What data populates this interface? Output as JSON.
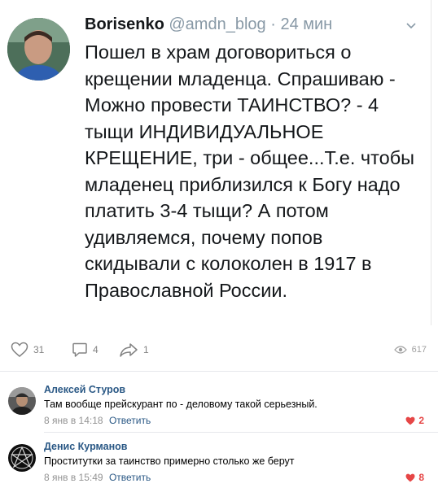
{
  "tweet": {
    "author_name": "Borisenko",
    "handle": "@amdn_blog",
    "separator": "·",
    "time": "24 мин",
    "text": "Пошел в храм договориться о крещении младенца. Спрашиваю - Можно провести ТАИНСТВО? - 4 тыщи ИНДИВИДУАЛЬНОЕ КРЕЩЕНИЕ, три - общее...Т.е. чтобы младенец приблизился к Богу надо платить 3-4 тыщи? А потом удивляемся, почему попов скидывали с колоколен в 1917 в Православной России."
  },
  "actions": {
    "likes": "31",
    "comments": "4",
    "shares": "1",
    "views": "617"
  },
  "comments": [
    {
      "author": "Алексей Стуров",
      "text": "Там вообще прейскурант по - деловому такой серьезный.",
      "time": "8 янв в 14:18",
      "reply_label": "Ответить",
      "likes": "2"
    },
    {
      "author": "Денис Курманов",
      "text": "Проститутки за таинство примерно столько же берут",
      "time": "8 янв в 15:49",
      "reply_label": "Ответить",
      "likes": "8"
    }
  ],
  "colors": {
    "link": "#2a5885",
    "like_active": "#e64646",
    "muted": "#939393"
  }
}
